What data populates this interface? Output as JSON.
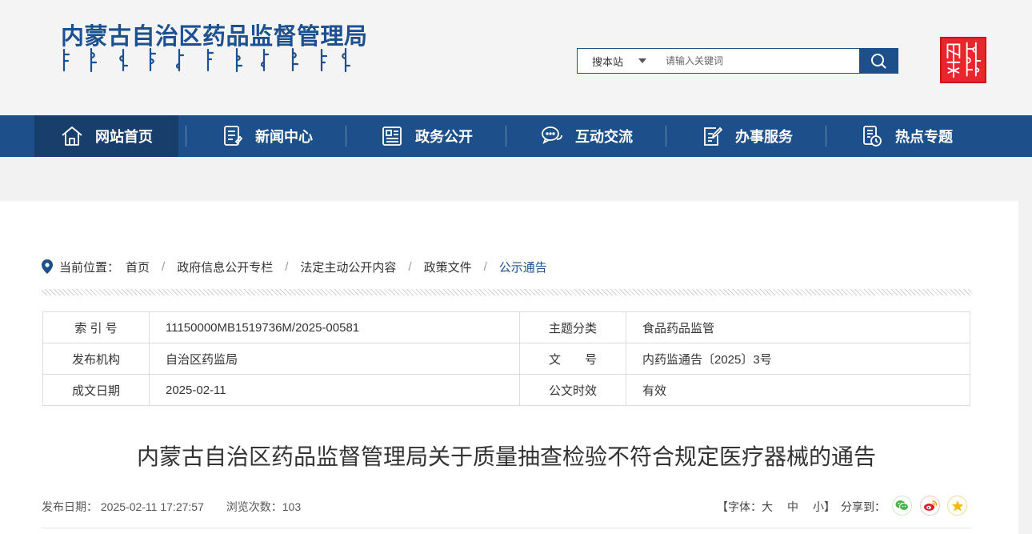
{
  "header": {
    "site_title": "内蒙古自治区药品监督管理局",
    "search": {
      "scope": "搜本站",
      "placeholder": "请输入关键词"
    },
    "seal_text": "内蒙古"
  },
  "nav": {
    "items": [
      {
        "label": "网站首页",
        "icon": "home-icon",
        "active": true
      },
      {
        "label": "新闻中心",
        "icon": "news-icon"
      },
      {
        "label": "政务公开",
        "icon": "government-icon"
      },
      {
        "label": "互动交流",
        "icon": "chat-icon"
      },
      {
        "label": "办事服务",
        "icon": "service-icon"
      },
      {
        "label": "热点专题",
        "icon": "topic-icon"
      }
    ]
  },
  "breadcrumb": {
    "label": "当前位置：",
    "items": [
      "首页",
      "政府信息公开专栏",
      "法定主动公开内容",
      "政策文件",
      "公示通告"
    ]
  },
  "meta_table": {
    "rows": [
      {
        "l1": "索 引 号",
        "v1": "11150000MB1519736M/2025-00581",
        "l2": "主题分类",
        "v2": "食品药品监管"
      },
      {
        "l1": "发布机构",
        "v1": "自治区药监局",
        "l2": "文　　号",
        "v2": "内药监通告〔2025〕3号"
      },
      {
        "l1": "成文日期",
        "v1": "2025-02-11",
        "l2": "公文时效",
        "v2": "有效"
      }
    ]
  },
  "article": {
    "title": "内蒙古自治区药品监督管理局关于质量抽查检验不符合规定医疗器械的通告",
    "publish_date": "发布日期： 2025-02-11 17:27:57",
    "views": "浏览次数：103",
    "font_label": "【字体：",
    "font_large": "大",
    "font_medium": "中",
    "font_small": "小】",
    "share_label": "分享到："
  },
  "colors": {
    "primary": "#1d4f8a",
    "nav_active": "#183f6c",
    "wechat": "#4cb34c",
    "weibo": "#e6162d",
    "qzone": "#f5b800"
  }
}
